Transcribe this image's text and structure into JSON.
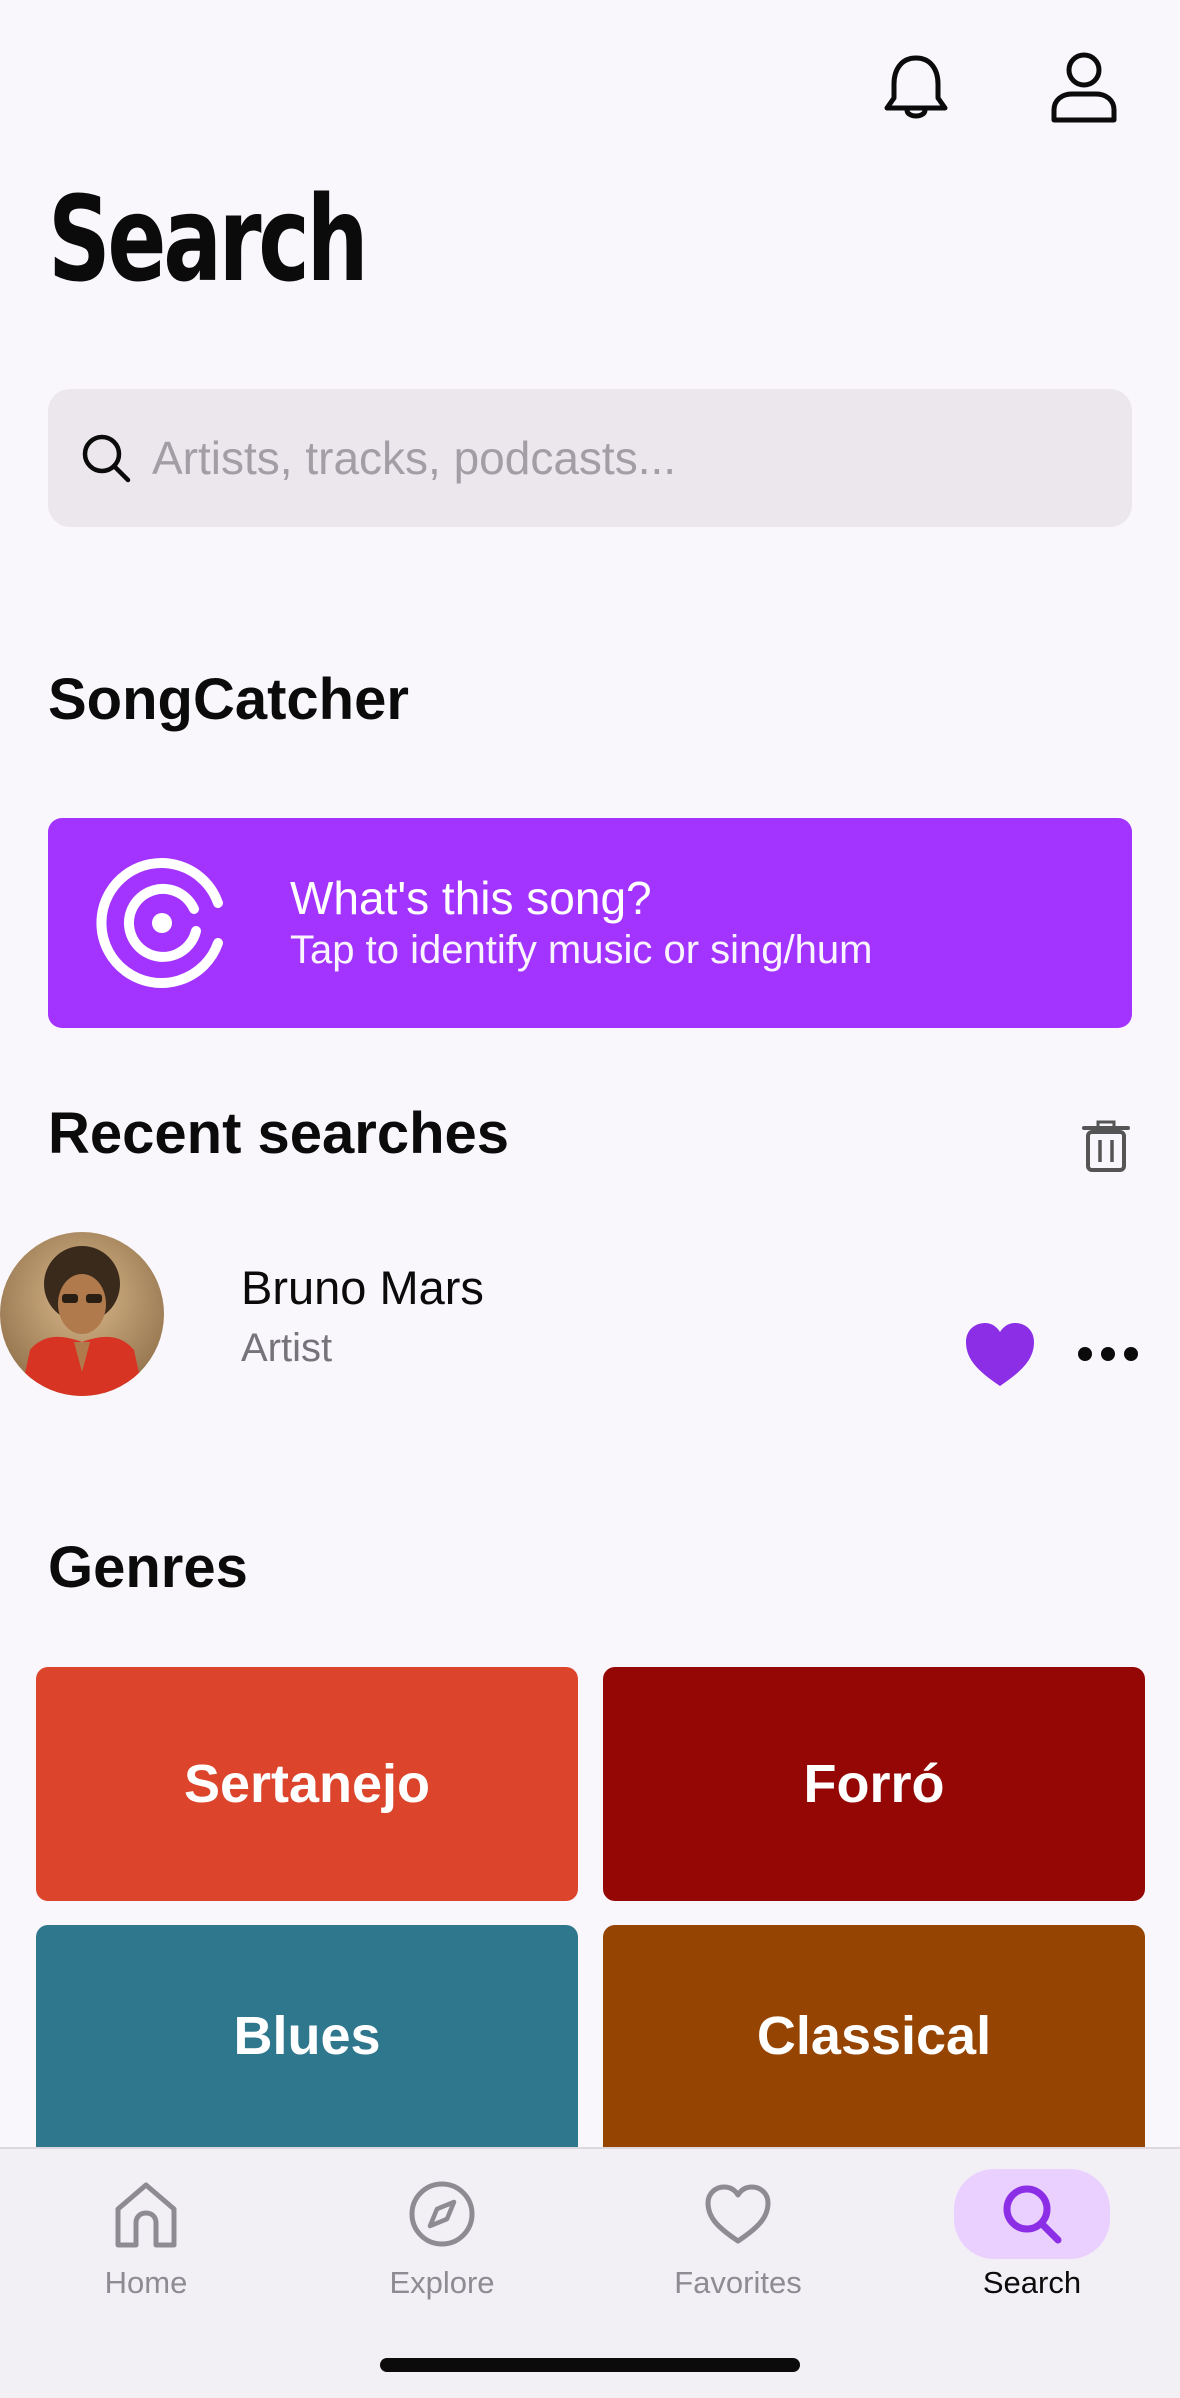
{
  "header": {
    "title": "Search",
    "notifications_icon": "bell-icon",
    "profile_icon": "user-icon"
  },
  "search": {
    "placeholder": "Artists, tracks, podcasts..."
  },
  "songcatcher": {
    "section_title": "SongCatcher",
    "title": "What's this song?",
    "subtitle": "Tap to identify music or sing/hum",
    "color": "#a333ff"
  },
  "recent": {
    "section_title": "Recent searches",
    "items": [
      {
        "name": "Bruno Mars",
        "type": "Artist",
        "favorited": true
      }
    ]
  },
  "genres": {
    "section_title": "Genres",
    "items": [
      {
        "label": "Sertanejo",
        "color": "#dc452c"
      },
      {
        "label": "Forró",
        "color": "#940704"
      },
      {
        "label": "Blues",
        "color": "#2f778d"
      },
      {
        "label": "Classical",
        "color": "#954401"
      }
    ]
  },
  "tabs": [
    {
      "label": "Home",
      "icon": "home-icon",
      "active": false
    },
    {
      "label": "Explore",
      "icon": "compass-icon",
      "active": false
    },
    {
      "label": "Favorites",
      "icon": "heart-icon",
      "active": false
    },
    {
      "label": "Search",
      "icon": "search-icon",
      "active": true
    }
  ],
  "accent_color": "#8c2ee6"
}
